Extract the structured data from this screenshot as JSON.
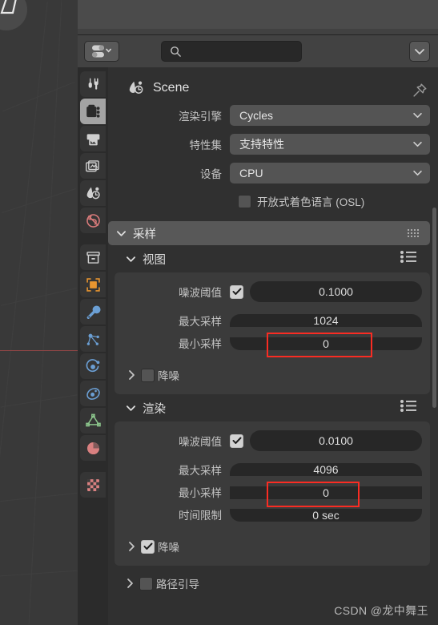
{
  "window": {
    "app": "Blender",
    "editor": "Properties"
  },
  "header": {
    "editor_type_icon": "properties-editor-icon",
    "editor_type_chevron": "chevron-down-icon",
    "search_icon": "search-icon",
    "search_placeholder": "",
    "search_value": "",
    "filter_icon": "chevron-down-icon"
  },
  "breadcrumb": {
    "scene_icon": "scene-icon",
    "label": "Scene",
    "pin_icon": "pin-icon"
  },
  "tabs": [
    {
      "name": "tool",
      "icon": "tool-icon",
      "active": false
    },
    {
      "name": "render",
      "icon": "camera-back-icon",
      "active": true
    },
    {
      "name": "output",
      "icon": "printer-icon",
      "active": false
    },
    {
      "name": "view-layer",
      "icon": "images-icon",
      "active": false
    },
    {
      "name": "scene",
      "icon": "scene-icon",
      "active": false
    },
    {
      "name": "world",
      "icon": "world-icon",
      "active": false
    },
    {
      "name": "collection",
      "icon": "collection-box-icon",
      "active": false
    },
    {
      "name": "object",
      "icon": "object-square-icon",
      "active": false
    },
    {
      "name": "modifiers",
      "icon": "wrench-icon",
      "active": false
    },
    {
      "name": "particles",
      "icon": "particles-icon",
      "active": false
    },
    {
      "name": "physics",
      "icon": "physics-orbit-icon",
      "active": false
    },
    {
      "name": "constraints",
      "icon": "constraint-icon",
      "active": false
    },
    {
      "name": "object-data",
      "icon": "mesh-data-icon",
      "active": false
    },
    {
      "name": "material",
      "icon": "material-sphere-icon",
      "active": false
    },
    {
      "name": "texture",
      "icon": "checker-texture-icon",
      "active": false
    }
  ],
  "render_settings": {
    "engine": {
      "label": "渲染引擎",
      "value": "Cycles"
    },
    "feature_set": {
      "label": "特性集",
      "value": "支持特性"
    },
    "device": {
      "label": "设备",
      "value": "CPU"
    },
    "osl": {
      "label": "开放式着色语言 (OSL)",
      "checked": false
    }
  },
  "sampling_panel": {
    "title": "采样",
    "expanded": true,
    "viewport": {
      "title": "视图",
      "expanded": true,
      "noise_threshold": {
        "label": "噪波阈值",
        "checked": true,
        "value": "0.1000"
      },
      "max_samples": {
        "label": "最大采样",
        "value": "1024",
        "highlighted": true
      },
      "min_samples": {
        "label": "最小采样",
        "value": "0",
        "highlighted": false
      },
      "denoise": {
        "label": "降噪",
        "checked": false,
        "expanded": false
      }
    },
    "render": {
      "title": "渲染",
      "expanded": true,
      "noise_threshold": {
        "label": "噪波阈值",
        "checked": true,
        "value": "0.0100"
      },
      "max_samples": {
        "label": "最大采样",
        "value": "4096",
        "highlighted": true
      },
      "min_samples": {
        "label": "最小采样",
        "value": "0",
        "highlighted": false
      },
      "time_limit": {
        "label": "时间限制",
        "value": "0 sec"
      },
      "denoise": {
        "label": "降噪",
        "checked": true,
        "expanded": false
      }
    },
    "path_guiding": {
      "label": "路径引导",
      "checked": false,
      "expanded": false
    }
  },
  "watermark": "CSDN @龙中舞王",
  "colors": {
    "highlight": "#fa2c23",
    "panel_bg": "#3b3b3b",
    "editor_bg": "#303030",
    "field_bg": "#272727",
    "dropdown_bg": "#545454"
  }
}
